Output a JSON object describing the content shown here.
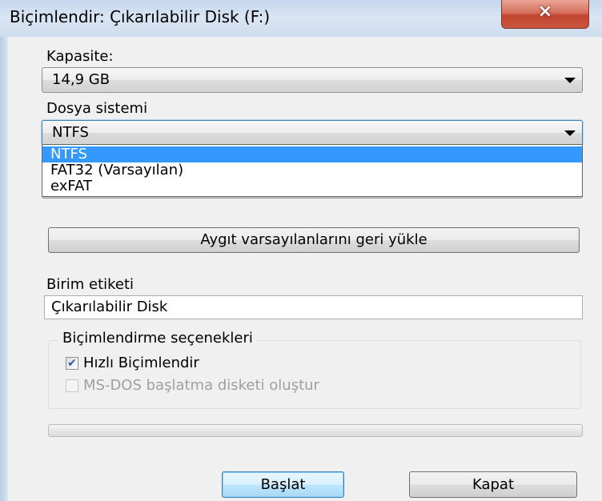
{
  "window": {
    "title": "Biçimlendir: Çıkarılabilir Disk (F:)",
    "close_icon": "×"
  },
  "capacity": {
    "label": "Kapasite:",
    "value": "14,9 GB"
  },
  "filesystem": {
    "label": "Dosya sistemi",
    "value": "NTFS",
    "options": [
      "NTFS",
      "FAT32 (Varsayılan)",
      "exFAT"
    ],
    "selected_index": 0
  },
  "restore_button": {
    "label": "Aygıt varsayılanlarını geri yükle"
  },
  "volume": {
    "label": "Birim etiketi",
    "value": "Çıkarılabilir Disk"
  },
  "format_options": {
    "legend": "Biçimlendirme seçenekleri",
    "quick": {
      "label": "Hızlı Biçimlendir",
      "checked": true,
      "check_glyph": "✔"
    },
    "msdos": {
      "label": "MS-DOS başlatma disketi oluştur",
      "checked": false,
      "enabled": false
    }
  },
  "progress": {
    "value": 0
  },
  "buttons": {
    "start": "Başlat",
    "close": "Kapat"
  },
  "colors": {
    "selection": "#3399ff",
    "close_button": "#c24530"
  }
}
